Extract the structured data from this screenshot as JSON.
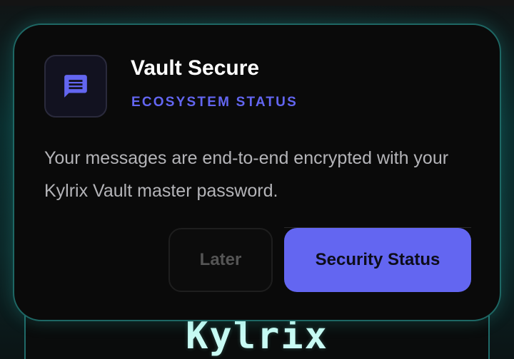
{
  "dialog": {
    "icon": "chat-message-icon",
    "title": "Vault Secure",
    "subtitle": "ECOSYSTEM STATUS",
    "body": "Your messages are end-to-end encrypted with your Kylrix Vault master password.",
    "later_label": "Later",
    "primary_label": "Security Status"
  },
  "background": {
    "brand_wordmark": "Kylrix"
  },
  "colors": {
    "accent": "#6366f1",
    "dialog_background": "#0a0a0a",
    "dialog_border": "#1e6764",
    "body_text": "#b4b4b8"
  }
}
